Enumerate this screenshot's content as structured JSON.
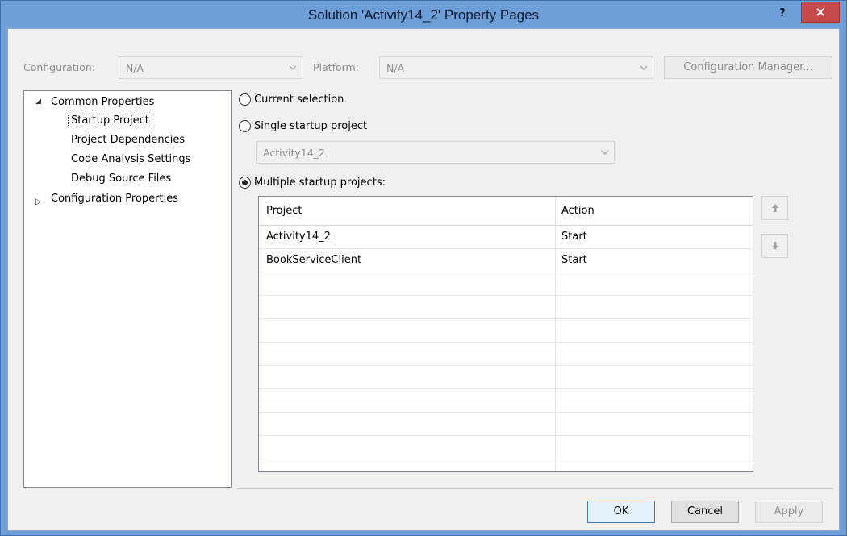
{
  "window": {
    "title": "Solution 'Activity14_2' Property Pages",
    "help_label": "?"
  },
  "toolbar": {
    "configuration_label": "Configuration:",
    "configuration_value": "N/A",
    "platform_label": "Platform:",
    "platform_value": "N/A",
    "config_manager_label": "Configuration Manager..."
  },
  "tree": {
    "common_properties": "Common Properties",
    "startup_project": "Startup Project",
    "project_dependencies": "Project Dependencies",
    "code_analysis_settings": "Code Analysis Settings",
    "debug_source_files": "Debug Source Files",
    "configuration_properties": "Configuration Properties"
  },
  "startup": {
    "current_selection_label": "Current selection",
    "single_startup_label": "Single startup project",
    "single_startup_value": "Activity14_2",
    "multiple_startup_label": "Multiple startup projects:",
    "selected_option": "multiple"
  },
  "grid": {
    "columns": [
      "Project",
      "Action"
    ],
    "rows": [
      {
        "project": "Activity14_2",
        "action": "Start"
      },
      {
        "project": "BookServiceClient",
        "action": "Start"
      }
    ]
  },
  "buttons": {
    "ok": "OK",
    "cancel": "Cancel",
    "apply": "Apply"
  },
  "colors": {
    "titlebar": "#6d9ed8",
    "close_button": "#c74a4a",
    "client_bg": "#f0f0f0"
  }
}
